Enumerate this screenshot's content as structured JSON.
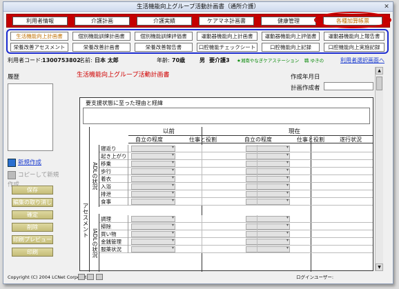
{
  "window": {
    "title": "生活機能向上グループ活動計画書（通所介護）"
  },
  "nav_primary": [
    {
      "label": "利用者情報",
      "active": false
    },
    {
      "label": "介護計画",
      "active": false
    },
    {
      "label": "介護実績",
      "active": false
    },
    {
      "label": "ケアマネ計画書",
      "active": false
    },
    {
      "label": "健康管理",
      "active": false
    },
    {
      "label": "各種加算帳票",
      "active": true
    }
  ],
  "nav_secondary": [
    {
      "label": "生活機能向上計画書",
      "active": true
    },
    {
      "label": "個別機能訓練計画書",
      "active": false
    },
    {
      "label": "個別機能訓練評価書",
      "active": false
    },
    {
      "label": "運動器機能向上計画書",
      "active": false
    },
    {
      "label": "運動器機能向上評価書",
      "active": false
    },
    {
      "label": "運動器機能向上報告書",
      "active": false
    },
    {
      "label": "栄養改善アセスメント",
      "active": false
    },
    {
      "label": "栄養改善計画書",
      "active": false
    },
    {
      "label": "栄養改善報告書",
      "active": false
    },
    {
      "label": "口腔機能チェックシート",
      "active": false
    },
    {
      "label": "口腔機能向上記録",
      "active": false
    },
    {
      "label": "口腔機能向上実施記録",
      "active": false
    }
  ],
  "user_info": {
    "code_label": "利用者コード:",
    "code": "1300753802",
    "name_label": "名前:",
    "name": "日本 太郎",
    "age_label": "年齢:",
    "age": "70歳",
    "sex": "男",
    "care_level": "要介護3",
    "facility": "★湘南やなぎケアステーション",
    "staff": "職 ゆきの",
    "select_link": "利用者選択画面へ"
  },
  "left_panel": {
    "history_label": "履歴",
    "new_link": "新規作成",
    "copy_link": "コピーして新規作成",
    "buttons": [
      "保存",
      "編集の取り消し",
      "確定",
      "削除",
      "印刷プレビュー",
      "印刷"
    ]
  },
  "form": {
    "title": "生活機能向上グループ活動計画書",
    "date_label": "作成年月日",
    "author_label": "計画作成者",
    "reason_label": "要支援状態に至った理由と経緯",
    "assessment_label": "アセスメント",
    "before_label": "以前",
    "current_label": "現在",
    "col_independence": "自立の程度",
    "col_work_role": "仕事と役割",
    "col_progress": "遂行状況",
    "adl_label": "ADLの状況",
    "iadl_label": "IADLの状況",
    "adl_items": [
      "寝返り",
      "起き上がり",
      "移乗",
      "歩行",
      "着衣",
      "入浴",
      "排泄",
      "食事"
    ],
    "iadl_items": [
      "調理",
      "掃除",
      "買い物",
      "金銭管理",
      "服薬状況"
    ]
  },
  "footer": {
    "copyright": "Copyright (C) 2004 LCNet Corporation",
    "login_label": "ログインユーザー:"
  }
}
